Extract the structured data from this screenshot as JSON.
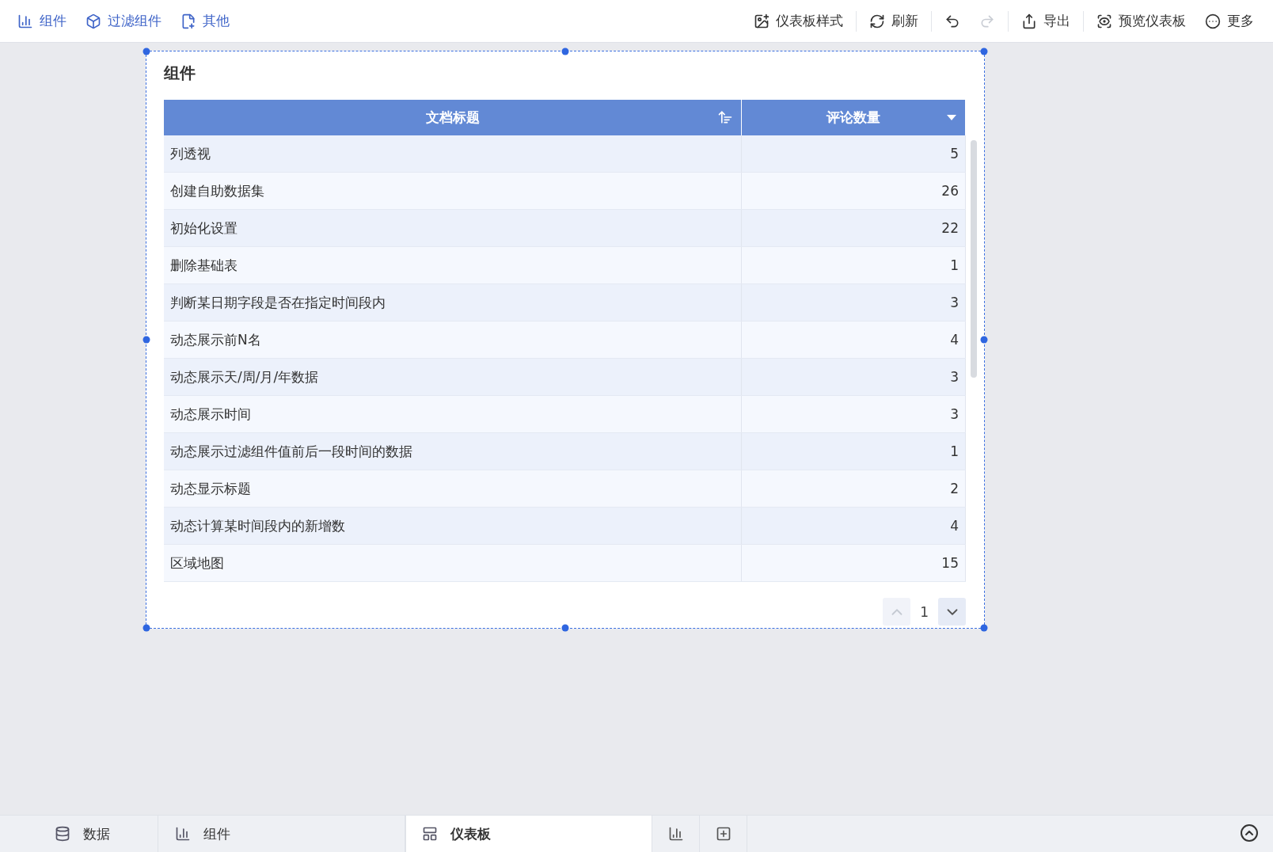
{
  "toolbar": {
    "left": [
      {
        "label": "组件",
        "kind": "chart-add"
      },
      {
        "label": "过滤组件",
        "kind": "filter"
      },
      {
        "label": "其他",
        "kind": "other"
      }
    ],
    "right": [
      {
        "label": "仪表板样式",
        "kind": "style",
        "disabled": false
      },
      {
        "label": "刷新",
        "kind": "refresh",
        "disabled": false
      },
      {
        "kind": "undo",
        "disabled": false
      },
      {
        "kind": "redo",
        "disabled": true
      },
      {
        "label": "导出",
        "kind": "export",
        "disabled": false
      },
      {
        "label": "预览仪表板",
        "kind": "preview",
        "disabled": false
      },
      {
        "label": "更多",
        "kind": "more",
        "disabled": false
      }
    ]
  },
  "widget": {
    "title": "组件",
    "table": {
      "columns": [
        {
          "label": "文档标题",
          "kind": "sortable"
        },
        {
          "label": "评论数量",
          "kind": "filterable"
        }
      ],
      "rows": [
        [
          "列透视",
          "5"
        ],
        [
          "创建自助数据集",
          "26"
        ],
        [
          "初始化设置",
          "22"
        ],
        [
          "删除基础表",
          "1"
        ],
        [
          "判断某日期字段是否在指定时间段内",
          "3"
        ],
        [
          "动态展示前N名",
          "4"
        ],
        [
          "动态展示天/周/月/年数据",
          "3"
        ],
        [
          "动态展示时间",
          "3"
        ],
        [
          "动态展示过滤组件值前后一段时间的数据",
          "1"
        ],
        [
          "动态显示标题",
          "2"
        ],
        [
          "动态计算某时间段内的新增数",
          "4"
        ],
        [
          "区域地图",
          "15"
        ]
      ]
    },
    "pager": {
      "page": "1",
      "prev_disabled": true,
      "next_disabled": false
    }
  },
  "bottom_tabs": [
    {
      "label": "数据",
      "kind": "data",
      "selected": false
    },
    {
      "label": "组件",
      "kind": "chart",
      "selected": false
    },
    {
      "label": "仪表板",
      "kind": "dashboard",
      "selected": true
    }
  ],
  "bottom_actions": [
    {
      "kind": "add-chart"
    },
    {
      "kind": "add-widget"
    }
  ]
}
